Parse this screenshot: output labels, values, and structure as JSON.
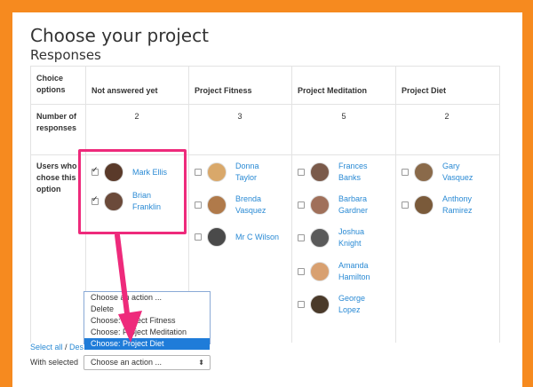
{
  "page": {
    "title": "Choose your project",
    "subtitle": "Responses"
  },
  "table": {
    "row_labels": {
      "choice_options": "Choice options",
      "number_of_responses": "Number of responses",
      "users_who_chose": "Users who chose this option"
    },
    "columns": [
      {
        "header": "Not answered yet",
        "count": "2",
        "users": [
          {
            "name": "Mark Ellis",
            "checked": true,
            "avatar_color": "#5a3a2a"
          },
          {
            "name": "Brian Franklin",
            "checked": true,
            "avatar_color": "#6b4a3a"
          }
        ]
      },
      {
        "header": "Project Fitness",
        "count": "3",
        "users": [
          {
            "name": "Donna Taylor",
            "checked": false,
            "avatar_color": "#d9a86a"
          },
          {
            "name": "Brenda Vasquez",
            "checked": false,
            "avatar_color": "#b07a4a"
          },
          {
            "name": "Mr C Wilson",
            "checked": false,
            "avatar_color": "#4a4a4a"
          }
        ]
      },
      {
        "header": "Project Meditation",
        "count": "5",
        "users": [
          {
            "name": "Frances Banks",
            "checked": false,
            "avatar_color": "#7a5a4a"
          },
          {
            "name": "Barbara Gardner",
            "checked": false,
            "avatar_color": "#a0705a"
          },
          {
            "name": "Joshua Knight",
            "checked": false,
            "avatar_color": "#5a5a5a"
          },
          {
            "name": "Amanda Hamilton",
            "checked": false,
            "avatar_color": "#d8a070"
          },
          {
            "name": "George Lopez",
            "checked": false,
            "avatar_color": "#4a3a2a"
          }
        ]
      },
      {
        "header": "Project Diet",
        "count": "2",
        "users": [
          {
            "name": "Gary Vasquez",
            "checked": false,
            "avatar_color": "#8a6a4a"
          },
          {
            "name": "Anthony Ramirez",
            "checked": false,
            "avatar_color": "#7a5a3a"
          }
        ]
      }
    ]
  },
  "dropdown": {
    "options": [
      {
        "label": "Choose an action ...",
        "selected": false
      },
      {
        "label": "Delete",
        "selected": false
      },
      {
        "label": "Choose: Project Fitness",
        "selected": false
      },
      {
        "label": "Choose: Project Meditation",
        "selected": false
      },
      {
        "label": "Choose: Project Diet",
        "selected": true
      }
    ]
  },
  "footer": {
    "select_all": "Select all",
    "separator": " / ",
    "deselect_all": "Des",
    "with_selected": "With selected",
    "select_value": "Choose an action ..."
  },
  "colors": {
    "background": "#f68a1f",
    "link": "#2a8ad4",
    "highlight": "#ee2a7b",
    "dropdown_selected": "#1f7cd9"
  }
}
